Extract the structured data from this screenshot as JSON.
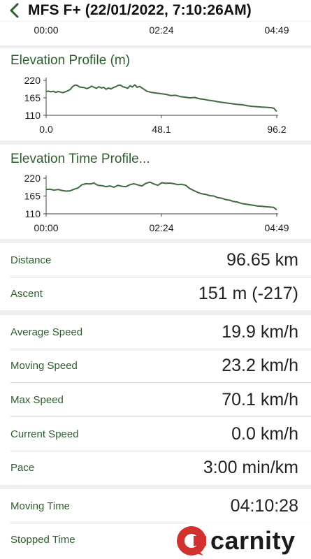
{
  "header": {
    "title": "MFS F+  (22/01/2022, 7:10:26AM)",
    "back_icon": "chevron-left-icon"
  },
  "top_axis": {
    "ticks": [
      "00:00",
      "02:24",
      "04:49"
    ]
  },
  "colors": {
    "accent": "#2e5e2e",
    "line": "#3d6b3d",
    "watermark_red": "#d2322d"
  },
  "elevation_profile": {
    "title": "Elevation Profile (m)",
    "chart_data": {
      "type": "line",
      "x_ticks": [
        "0.0",
        "48.1",
        "96.2"
      ],
      "y_ticks": [
        "220",
        "165",
        "110"
      ],
      "xlim": [
        0,
        96.2
      ],
      "ylim": [
        110,
        220
      ],
      "x": [
        0,
        1,
        2,
        3,
        4,
        5,
        6,
        7,
        8,
        9,
        10,
        11,
        12,
        13,
        14,
        15,
        16,
        17,
        18,
        19,
        20,
        21,
        22,
        23,
        24,
        25,
        26,
        27,
        28,
        29,
        30,
        31,
        32,
        33,
        34,
        35,
        36,
        37,
        38,
        39,
        40,
        42,
        44,
        46,
        48,
        50,
        52,
        54,
        56,
        58,
        60,
        62,
        64,
        66,
        68,
        70,
        72,
        74,
        76,
        78,
        80,
        82,
        84,
        86,
        88,
        90,
        92,
        94,
        95,
        96.2
      ],
      "y": [
        185,
        186,
        184,
        186,
        182,
        185,
        183,
        181,
        184,
        187,
        191,
        200,
        205,
        204,
        199,
        198,
        197,
        194,
        197,
        202,
        198,
        195,
        200,
        196,
        198,
        192,
        196,
        193,
        197,
        200,
        204,
        205,
        200,
        198,
        195,
        203,
        199,
        206,
        198,
        201,
        196,
        186,
        182,
        180,
        178,
        176,
        172,
        173,
        169,
        167,
        165,
        166,
        162,
        160,
        157,
        155,
        152,
        150,
        148,
        146,
        144,
        143,
        140,
        138,
        137,
        136,
        135,
        134,
        132,
        122
      ]
    }
  },
  "elevation_time_profile": {
    "title": "Elevation Time Profile...",
    "chart_data": {
      "type": "line",
      "x_ticks": [
        "00:00",
        "02:24",
        "04:49"
      ],
      "y_ticks": [
        "220",
        "165",
        "110"
      ],
      "xlim": [
        0,
        289
      ],
      "ylim": [
        110,
        220
      ],
      "x": [
        0,
        5,
        10,
        15,
        20,
        25,
        30,
        35,
        40,
        45,
        50,
        55,
        60,
        65,
        70,
        75,
        80,
        85,
        90,
        95,
        100,
        105,
        110,
        115,
        120,
        125,
        130,
        135,
        140,
        145,
        150,
        155,
        160,
        165,
        170,
        175,
        180,
        185,
        190,
        195,
        200,
        205,
        210,
        215,
        220,
        225,
        230,
        235,
        240,
        245,
        250,
        255,
        260,
        265,
        270,
        275,
        280,
        285,
        289
      ],
      "y": [
        185,
        186,
        183,
        185,
        182,
        180,
        181,
        186,
        190,
        200,
        203,
        202,
        205,
        198,
        197,
        194,
        196,
        192,
        198,
        195,
        194,
        200,
        203,
        199,
        196,
        204,
        208,
        202,
        198,
        206,
        204,
        205,
        203,
        200,
        201,
        198,
        188,
        182,
        176,
        172,
        170,
        166,
        165,
        160,
        158,
        154,
        152,
        148,
        146,
        142,
        140,
        138,
        136,
        134,
        133,
        132,
        131,
        130,
        122
      ]
    }
  },
  "stats_group_1": [
    {
      "label": "Distance",
      "value": "96.65 km"
    },
    {
      "label": "Ascent",
      "value": "151 m (-217)"
    }
  ],
  "stats_group_2": [
    {
      "label": "Average Speed",
      "value": "19.9 km/h"
    },
    {
      "label": "Moving Speed",
      "value": "23.2 km/h"
    },
    {
      "label": "Max Speed",
      "value": "70.1 km/h"
    },
    {
      "label": "Current Speed",
      "value": "0.0 km/h"
    },
    {
      "label": "Pace",
      "value": "3:00 min/km"
    }
  ],
  "stats_group_3": [
    {
      "label": "Moving Time",
      "value": "04:10:28"
    },
    {
      "label": "Stopped Time",
      "value": ""
    }
  ],
  "watermark": {
    "text": "carnity",
    "icon": "carnity-logo-icon"
  }
}
